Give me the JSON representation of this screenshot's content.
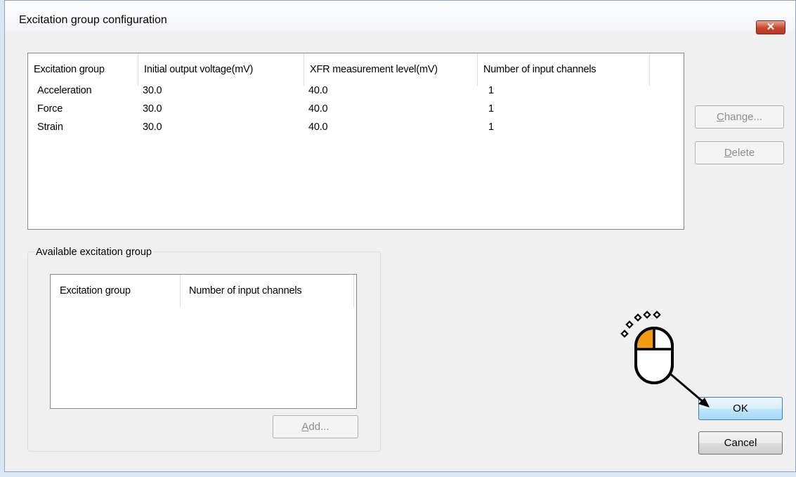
{
  "window": {
    "title": "Excitation group configuration",
    "close_glyph": "✕"
  },
  "configured": {
    "columns": [
      "Excitation group",
      "Initial output voltage(mV)",
      "XFR measurement level(mV)",
      "Number of input channels"
    ],
    "rows": [
      [
        "Acceleration",
        "30.0",
        "40.0",
        "1"
      ],
      [
        "Force",
        "30.0",
        "40.0",
        "1"
      ],
      [
        "Strain",
        "30.0",
        "40.0",
        "1"
      ]
    ]
  },
  "buttons": {
    "change": {
      "mnemonic": "C",
      "rest": "hange..."
    },
    "delete": {
      "mnemonic": "D",
      "rest": "elete"
    },
    "add": {
      "mnemonic": "A",
      "rest": "dd..."
    },
    "ok": "OK",
    "cancel": "Cancel"
  },
  "available": {
    "label": "Available excitation group",
    "columns": [
      "Excitation group",
      "Number of input channels"
    ]
  },
  "icons": {
    "close": "close-icon",
    "cursor": "mouse-click-icon"
  },
  "colors": {
    "accent": "#f39c12",
    "close_button": "#c9462c",
    "ok_border": "#3c7fb1"
  }
}
